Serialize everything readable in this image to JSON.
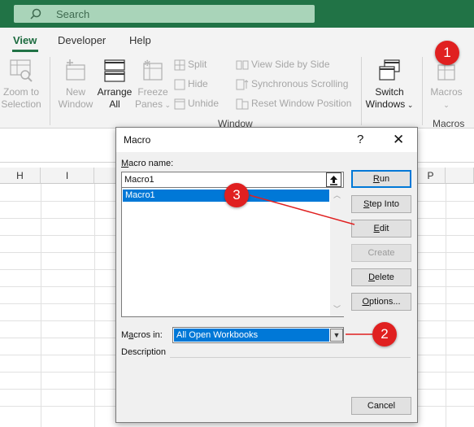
{
  "search": {
    "placeholder": "Search"
  },
  "tabs": [
    {
      "label": "View",
      "active": true
    },
    {
      "label": "Developer",
      "active": false
    },
    {
      "label": "Help",
      "active": false
    }
  ],
  "ribbon": {
    "zoom_to_selection": [
      "Zoom to",
      "Selection"
    ],
    "new_window": [
      "New",
      "Window"
    ],
    "arrange_all": [
      "Arrange",
      "All"
    ],
    "freeze_panes": [
      "Freeze",
      "Panes"
    ],
    "split": "Split",
    "hide": "Hide",
    "unhide": "Unhide",
    "view_side_by_side": "View Side by Side",
    "synchronous_scrolling": "Synchronous Scrolling",
    "reset_window_position": "Reset Window Position",
    "switch_windows": [
      "Switch",
      "Windows"
    ],
    "macros": "Macros",
    "group_window": "Window",
    "group_macros": "Macros"
  },
  "columns": [
    "H",
    "I",
    "P"
  ],
  "dialog": {
    "title": "Macro",
    "help": "?",
    "close": "✕",
    "macro_name_label": {
      "first": "M",
      "rest": "acro name:"
    },
    "macro_name_value": "Macro1",
    "list_items": [
      "Macro1"
    ],
    "buttons": {
      "run": {
        "first": "R",
        "rest": "un"
      },
      "step_into": {
        "first": "S",
        "rest": "tep Into"
      },
      "edit": {
        "first": "E",
        "rest": "dit"
      },
      "create": "Create",
      "delete": {
        "first": "D",
        "rest": "elete"
      },
      "options": {
        "first": "O",
        "rest": "ptions..."
      },
      "cancel": "Cancel"
    },
    "macros_in_label": {
      "pre": "M",
      "u": "a",
      "post": "cros in:"
    },
    "macros_in_value": "All Open Workbooks",
    "description_label": "Description"
  },
  "callouts": [
    "1",
    "2",
    "3"
  ],
  "colors": {
    "accent": "#217346",
    "callout": "#e02020",
    "selection": "#0078d7"
  }
}
